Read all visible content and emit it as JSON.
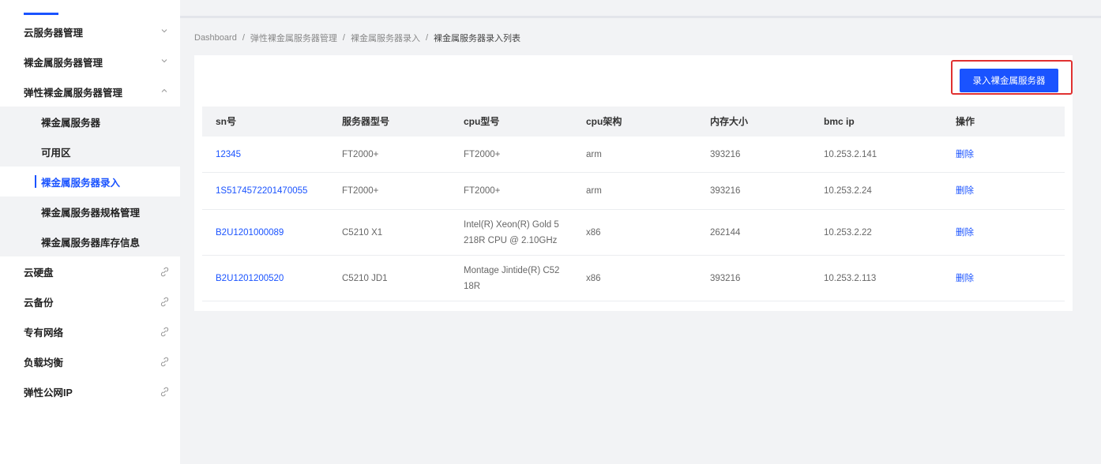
{
  "sidebar": {
    "items": [
      {
        "label": "云服务器管理",
        "icon": "chevron-down-icon"
      },
      {
        "label": "裸金属服务器管理",
        "icon": "chevron-down-icon"
      },
      {
        "label": "弹性裸金属服务器管理",
        "icon": "chevron-up-icon"
      },
      {
        "label": "裸金属服务器",
        "sub": true
      },
      {
        "label": "可用区",
        "sub": true
      },
      {
        "label": "裸金属服务器录入",
        "sub": true,
        "active": true
      },
      {
        "label": "裸金属服务器规格管理",
        "sub": true
      },
      {
        "label": "裸金属服务器库存信息",
        "sub": true
      },
      {
        "label": "云硬盘",
        "icon": "link-icon"
      },
      {
        "label": "云备份",
        "icon": "link-icon"
      },
      {
        "label": "专有网络",
        "icon": "link-icon"
      },
      {
        "label": "负载均衡",
        "icon": "link-icon"
      },
      {
        "label": "弹性公网IP",
        "icon": "link-icon"
      }
    ]
  },
  "breadcrumb": {
    "items": [
      "Dashboard",
      "弹性裸金属服务器管理",
      "裸金属服务器录入",
      "裸金属服务器录入列表"
    ],
    "separator": "/"
  },
  "toolbar": {
    "add_button": "录入裸金属服务器"
  },
  "table": {
    "headers": [
      "sn号",
      "服务器型号",
      "cpu型号",
      "cpu架构",
      "内存大小",
      "bmc ip",
      "操作"
    ],
    "rows": [
      {
        "sn": "12345",
        "model": "FT2000+",
        "cpu": "FT2000+",
        "cpu_extra": "",
        "arch": "arm",
        "memory": "393216",
        "bmc": "10.253.2.141",
        "action": "删除"
      },
      {
        "sn": "1S5174572201470055",
        "model": "FT2000+",
        "cpu": "FT2000+",
        "cpu_extra": "",
        "arch": "arm",
        "memory": "393216",
        "bmc": "10.253.2.24",
        "action": "删除"
      },
      {
        "sn": "B2U1201000089",
        "model": "C5210 X1",
        "cpu": "Intel(R) Xeon(R) Gold 5",
        "cpu_extra": "218R CPU @ 2.10GHz",
        "arch": "x86",
        "memory": "262144",
        "bmc": "10.253.2.22",
        "action": "删除"
      },
      {
        "sn": "B2U1201200520",
        "model": "C5210 JD1",
        "cpu": "Montage Jintide(R) C52",
        "cpu_extra": "18R",
        "arch": "x86",
        "memory": "393216",
        "bmc": "10.253.2.113",
        "action": "删除"
      }
    ]
  },
  "colors": {
    "accent": "#1a53ff",
    "highlight": "#e03131",
    "background": "#f2f3f5"
  }
}
